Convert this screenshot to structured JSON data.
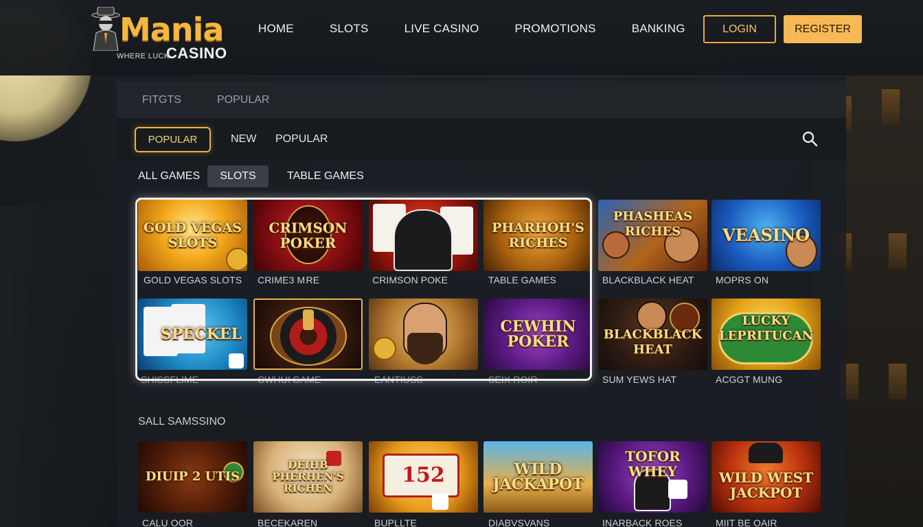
{
  "brand": {
    "name": "Mania",
    "tagline": "WHERE LUCK",
    "sub": "CASINO"
  },
  "nav": {
    "items": [
      "HOME",
      "SLOTS",
      "LIVE CASINO",
      "PROMOTIONS",
      "BANKING"
    ],
    "login": "LOGIN",
    "register": "REGISTER"
  },
  "top_tabs": [
    "FITGTS",
    "POPULAR"
  ],
  "filters": {
    "active": "POPULAR",
    "others": [
      "NEW",
      "POPULAR"
    ]
  },
  "categories": {
    "all": "ALL GAMES",
    "active": "SLOTS",
    "table": "TABLE GAMES"
  },
  "grid": {
    "row1": [
      {
        "art": "GOLD VEGAS SLOTS",
        "caption": "GOLD VEGAS SLOTS"
      },
      {
        "art": "CRIMSON POKER",
        "caption": "CRIME3 M RE"
      },
      {
        "art": "",
        "caption": "CRIMSON POKE"
      },
      {
        "art": "PHARHOH'S RICHES",
        "caption": "TABLE GAMES"
      },
      {
        "art": "PHASHEAS RICHES",
        "caption": "BLACKBLACK HEAT"
      },
      {
        "art": "VEASINO",
        "caption": "MOPRS ON"
      }
    ],
    "row2": [
      {
        "art": "SPECKEL",
        "caption": "SHISSFLIME"
      },
      {
        "art": "",
        "caption": "CWHUI GAME"
      },
      {
        "art": "",
        "caption": "EANTIUSS"
      },
      {
        "art": "CEWHIN POKER",
        "caption": "SEIX ROIR"
      },
      {
        "art": "BLACKBLACK HEAT",
        "caption": "SUM YEWS HAT"
      },
      {
        "art": "LUCKY LEPRITUCAN",
        "caption": "ACGGT MUNG"
      }
    ]
  },
  "section2": {
    "title": "SALL SAMSSINO",
    "tiles": [
      {
        "art": "DIUIP 2 UTIS",
        "caption": "CALU OOR"
      },
      {
        "art": "DEIHB PHERHEN'S RICHEN",
        "caption": "BECEKAREN"
      },
      {
        "art": "152",
        "caption": "BUPLLTE"
      },
      {
        "art": "WILD JACKAPOT",
        "caption": "DIABVSVANS"
      },
      {
        "art": "TOFOR WHEY",
        "caption": "INARBACK ROES"
      },
      {
        "art": "WILD WEST JACKPOT",
        "caption": "MIIT BE OAIR"
      }
    ]
  },
  "colors": {
    "accent": "#f7b955",
    "gold": "#e9b444",
    "background": "#15191d"
  }
}
